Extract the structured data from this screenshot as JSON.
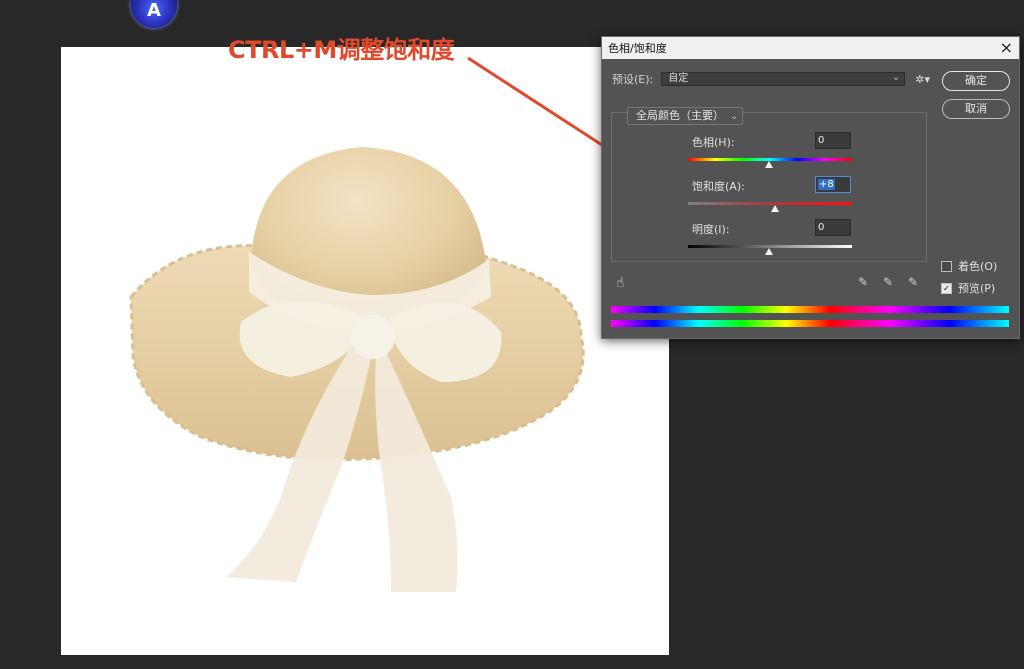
{
  "annotation": {
    "text": "CTRL+M调整饱和度",
    "color": "#e0492c"
  },
  "logo": {
    "letter": "A"
  },
  "dialog": {
    "title": "色相/饱和度",
    "close": "×",
    "preset_label": "预设(E):",
    "preset_value": "自定",
    "ok_label": "确定",
    "cancel_label": "取消",
    "channel": "全局颜色（主要）",
    "hue": {
      "label": "色相(H):",
      "value": "0",
      "level": 0.5
    },
    "saturation": {
      "label": "饱和度(A):",
      "value": "+8",
      "level": 0.53
    },
    "lightness": {
      "label": "明度(I):",
      "value": "0",
      "level": 0.5
    },
    "colorize_label": "着色(O)",
    "colorize_checked": false,
    "preview_label": "预览(P)",
    "preview_checked": true
  },
  "icons": [
    "gear-icon",
    "hand-icon",
    "eyedropper-icon",
    "eyedropper-plus-icon",
    "eyedropper-minus-icon",
    "close-icon",
    "chevron-down-icon"
  ]
}
